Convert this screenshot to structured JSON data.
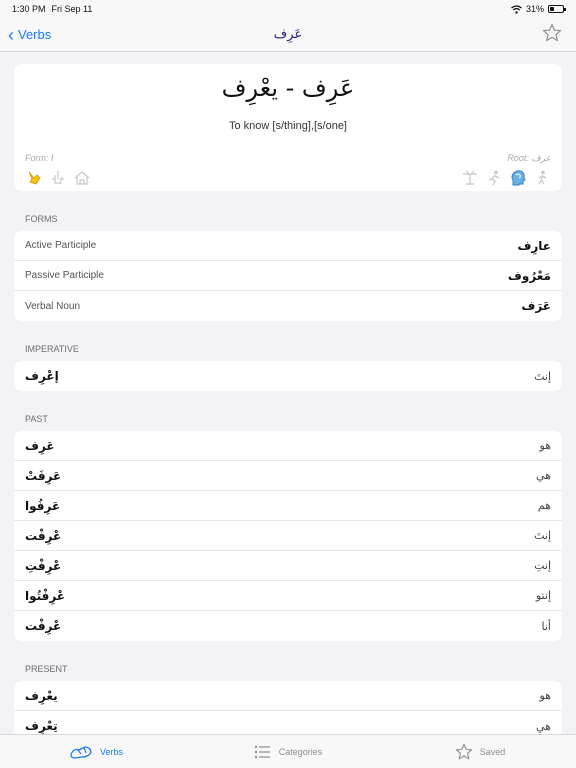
{
  "status_bar": {
    "time": "1:30 PM",
    "date": "Fri Sep 11",
    "battery": "31%",
    "battery_level": 0.31
  },
  "nav": {
    "back_label": "Verbs",
    "title": "عَرِف"
  },
  "verb": {
    "heading": "عَرِف - يعْرِف",
    "meaning": "To know [s/thing],[s/one]",
    "form": "Form: I",
    "root": "Root: عرف"
  },
  "forms": {
    "title": "FORMS",
    "rows": [
      {
        "label": "Active Participle",
        "value": "عارِف"
      },
      {
        "label": "Passive Participle",
        "value": "مَعْرُوف"
      },
      {
        "label": "Verbal Noun",
        "value": "عَرَف"
      }
    ]
  },
  "imperative": {
    "title": "IMPERATIVE",
    "rows": [
      {
        "value": "إعْرِف",
        "pronoun": "إنتَ"
      }
    ]
  },
  "past": {
    "title": "PAST",
    "rows": [
      {
        "value": "عَرِف",
        "pronoun": "هو"
      },
      {
        "value": "عَرِفَتْ",
        "pronoun": "هي"
      },
      {
        "value": "عَرِفُوا",
        "pronoun": "هم"
      },
      {
        "value": "عْرِفْت",
        "pronoun": "إنتَ"
      },
      {
        "value": "عْرِفْتِ",
        "pronoun": "إنتِ"
      },
      {
        "value": "عْرِفْتُوا",
        "pronoun": "إنتو"
      },
      {
        "value": "عْرِفْت",
        "pronoun": "أنا"
      }
    ]
  },
  "present": {
    "title": "PRESENT",
    "rows": [
      {
        "value": "يعْرِف",
        "pronoun": "هو"
      },
      {
        "value": "تِعْرِف",
        "pronoun": "هي"
      }
    ]
  },
  "tabs": [
    {
      "label": "Verbs",
      "icon": "verbs-icon",
      "active": true
    },
    {
      "label": "Categories",
      "icon": "list-icon",
      "active": false
    },
    {
      "label": "Saved",
      "icon": "star-icon",
      "active": false
    }
  ],
  "colors": {
    "accent": "#1a7cf5",
    "title": "#2b1a7a",
    "highlight": "#f5c518"
  }
}
